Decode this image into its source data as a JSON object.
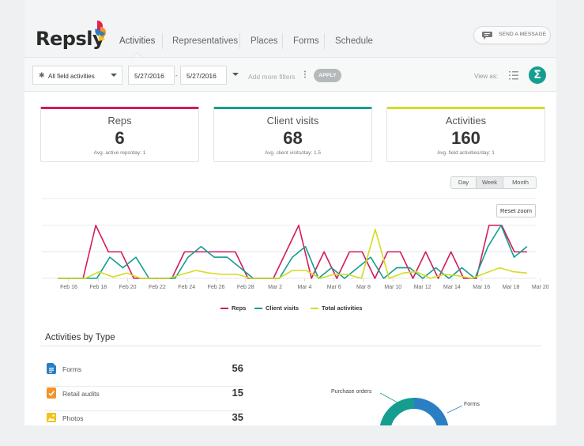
{
  "brand": {
    "name": "Repsly"
  },
  "nav": {
    "tabs": [
      {
        "label": "Activities",
        "active": true
      },
      {
        "label": "Representatives"
      },
      {
        "label": "Places"
      },
      {
        "label": "Forms"
      },
      {
        "label": "Schedule"
      }
    ],
    "send_message": "SEND A MESSAGE"
  },
  "filters": {
    "activity_type": "All field activities",
    "date_from": "5/27/2016",
    "date_separator": "-",
    "date_to": "5/27/2016",
    "more_filters": "Add more filters",
    "apply": "APPLY",
    "view_as": "View as:",
    "sigma": "Σ"
  },
  "cards": [
    {
      "title": "Reps",
      "value": "6",
      "sub": "Avg. active reps/day: 1",
      "color": "#d31c5b"
    },
    {
      "title": "Client visits",
      "value": "68",
      "sub": "Avg. client visits/day: 1.5",
      "color": "#159e8f"
    },
    {
      "title": "Activities",
      "value": "160",
      "sub": "Avg. field activities/day: 1",
      "color": "#d4dc25"
    }
  ],
  "period": {
    "day": "Day",
    "week": "Week",
    "month": "Month",
    "selected": "Week"
  },
  "reset_zoom": "Reset zoom",
  "chart_data": {
    "type": "line",
    "x_ticks": [
      "Feb 16",
      "Feb 18",
      "Feb 20",
      "Feb 22",
      "Feb 24",
      "Feb 26",
      "Feb 28",
      "Mar 2",
      "Mar 4",
      "Mar 6",
      "Mar 8",
      "Mar 10",
      "Mar 12",
      "Mar 14",
      "Mar 16",
      "Mar 18",
      "Mar 20"
    ],
    "y_range": [
      0,
      4
    ],
    "grid": true,
    "legend_position": "bottom",
    "series": [
      {
        "name": "Reps",
        "color": "#d31c5b",
        "values": [
          0,
          0,
          0,
          4,
          2,
          2,
          0,
          0,
          0,
          0,
          2,
          2,
          2,
          2,
          2,
          0,
          0,
          0,
          2,
          4,
          0,
          2,
          0,
          2,
          2,
          0,
          2,
          2,
          0,
          2,
          0,
          2,
          0,
          0,
          4,
          4,
          2,
          2
        ]
      },
      {
        "name": "Client visits",
        "color": "#159e8f",
        "values": [
          0,
          0,
          0,
          0,
          1.6,
          0.8,
          1.6,
          0,
          0,
          0,
          1.6,
          2.4,
          1.6,
          1.6,
          0.8,
          0,
          0,
          0,
          1.6,
          2.4,
          0,
          0.8,
          0,
          0.8,
          1.6,
          0,
          0.8,
          0.8,
          0,
          0.8,
          0,
          0.8,
          0,
          2.4,
          4,
          1.6,
          2.4
        ]
      },
      {
        "name": "Total activities",
        "color": "#d4dc25",
        "values": [
          0,
          0,
          0,
          0.5,
          0.1,
          0.4,
          0,
          0,
          0,
          0.3,
          0.6,
          0.4,
          0.3,
          0.3,
          0,
          0,
          0,
          0.6,
          0.6,
          0,
          0.3,
          0.3,
          0,
          3.7,
          0,
          0.4,
          0.5,
          0,
          0.3,
          0.2,
          0,
          0.4,
          0.8,
          0.5,
          0.4
        ]
      }
    ]
  },
  "activities_by_type": {
    "title": "Activities by Type",
    "rows": [
      {
        "label": "Forms",
        "value": "56",
        "color": "#2a7fc4",
        "icon": "form-icon"
      },
      {
        "label": "Retail audits",
        "value": "15",
        "color": "#f29428",
        "icon": "audit-icon"
      },
      {
        "label": "Photos",
        "value": "35",
        "color": "#f3c21a",
        "icon": "photo-icon"
      }
    ],
    "donut_labels": {
      "purchase_orders": "Purchase orders",
      "forms": "Forms"
    }
  }
}
